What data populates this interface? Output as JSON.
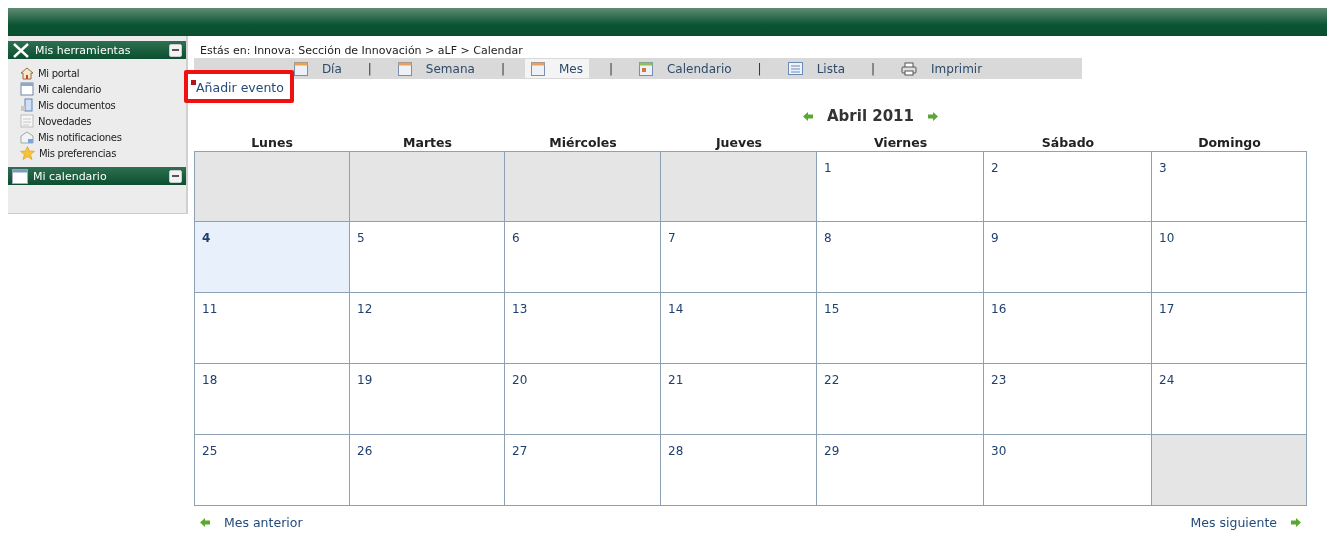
{
  "sidebar": {
    "panels": [
      {
        "title": "Mis herramientas",
        "kind": "tools",
        "items": [
          {
            "label": "Mi portal",
            "kind": "home"
          },
          {
            "label": "Mi calendario",
            "kind": "calendar"
          },
          {
            "label": "Mis documentos",
            "kind": "document"
          },
          {
            "label": "Novedades",
            "kind": "news"
          },
          {
            "label": "Mis notificaciones",
            "kind": "mail"
          },
          {
            "label": "Mis preferencias",
            "kind": "star"
          }
        ]
      },
      {
        "title": "Mi calendario",
        "kind": "calendar"
      }
    ]
  },
  "breadcrumb": "Estás en: Innova: Sección de Innovación > aLF > Calendar",
  "toolbar": [
    {
      "kind": "tab",
      "label": "Día",
      "selected": false
    },
    {
      "kind": "separator",
      "label": "|"
    },
    {
      "kind": "tab",
      "label": "Semana",
      "selected": false
    },
    {
      "kind": "separator",
      "label": "|"
    },
    {
      "kind": "tab",
      "label": "Mes",
      "selected": true
    },
    {
      "kind": "separator",
      "label": "|"
    },
    {
      "kind": "tab",
      "label": "Calendario",
      "selected": false
    },
    {
      "kind": "separator",
      "label": "|"
    },
    {
      "kind": "tab",
      "label": "Lista",
      "selected": false
    },
    {
      "kind": "separator",
      "label": "|"
    },
    {
      "kind": "tab",
      "label": "Imprimir",
      "selected": false
    }
  ],
  "add_event": {
    "label": "Añadir evento",
    "highlighted": true
  },
  "month_title": "Abril 2011",
  "weekdays": [
    "Lunes",
    "Martes",
    "Miércoles",
    "Jueves",
    "Viernes",
    "Sábado",
    "Domingo"
  ],
  "days": [
    {
      "kind": "blank"
    },
    {
      "kind": "blank"
    },
    {
      "kind": "blank"
    },
    {
      "kind": "blank"
    },
    {
      "kind": "day",
      "number": "1",
      "today": false
    },
    {
      "kind": "day",
      "number": "2",
      "today": false
    },
    {
      "kind": "day",
      "number": "3",
      "today": false
    },
    {
      "kind": "day",
      "number": "4",
      "today": true
    },
    {
      "kind": "day",
      "number": "5",
      "today": false
    },
    {
      "kind": "day",
      "number": "6",
      "today": false
    },
    {
      "kind": "day",
      "number": "7",
      "today": false
    },
    {
      "kind": "day",
      "number": "8",
      "today": false
    },
    {
      "kind": "day",
      "number": "9",
      "today": false
    },
    {
      "kind": "day",
      "number": "10",
      "today": false
    },
    {
      "kind": "day",
      "number": "11",
      "today": false
    },
    {
      "kind": "day",
      "number": "12",
      "today": false
    },
    {
      "kind": "day",
      "number": "13",
      "today": false
    },
    {
      "kind": "day",
      "number": "14",
      "today": false
    },
    {
      "kind": "day",
      "number": "15",
      "today": false
    },
    {
      "kind": "day",
      "number": "16",
      "today": false
    },
    {
      "kind": "day",
      "number": "17",
      "today": false
    },
    {
      "kind": "day",
      "number": "18",
      "today": false
    },
    {
      "kind": "day",
      "number": "19",
      "today": false
    },
    {
      "kind": "day",
      "number": "20",
      "today": false
    },
    {
      "kind": "day",
      "number": "21",
      "today": false
    },
    {
      "kind": "day",
      "number": "22",
      "today": false
    },
    {
      "kind": "day",
      "number": "23",
      "today": false
    },
    {
      "kind": "day",
      "number": "24",
      "today": false
    },
    {
      "kind": "day",
      "number": "25",
      "today": false
    },
    {
      "kind": "day",
      "number": "26",
      "today": false
    },
    {
      "kind": "day",
      "number": "27",
      "today": false
    },
    {
      "kind": "day",
      "number": "28",
      "today": false
    },
    {
      "kind": "day",
      "number": "29",
      "today": false
    },
    {
      "kind": "day",
      "number": "30",
      "today": false
    },
    {
      "kind": "blank"
    }
  ],
  "prev_month": "Mes anterior",
  "next_month": "Mes siguiente"
}
